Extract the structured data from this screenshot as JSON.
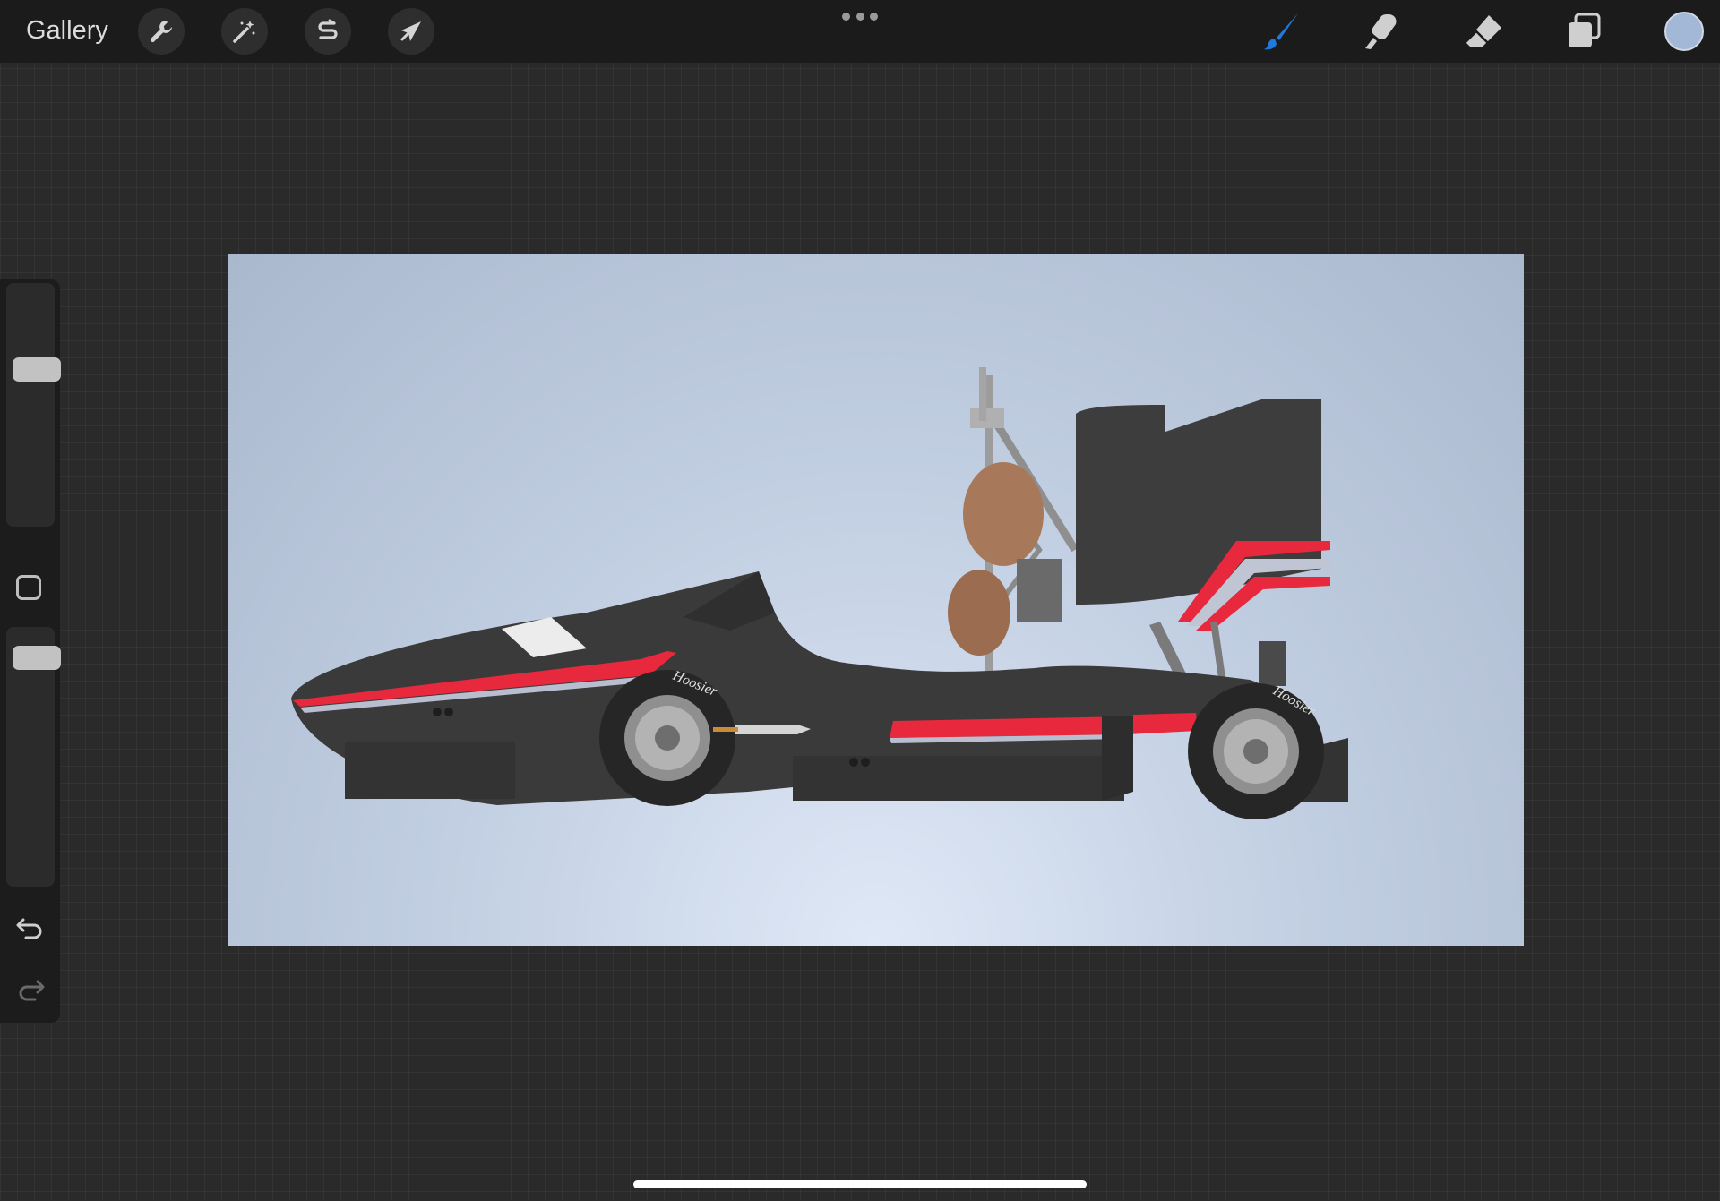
{
  "topbar": {
    "gallery_label": "Gallery",
    "left_tools": [
      {
        "name": "actions",
        "icon": "wrench-icon"
      },
      {
        "name": "adjustments",
        "icon": "magic-wand-icon"
      },
      {
        "name": "selection",
        "icon": "selection-s-icon"
      },
      {
        "name": "transform",
        "icon": "arrow-cursor-icon"
      }
    ],
    "more_icon": "ellipsis-icon",
    "right_tools": [
      {
        "name": "brush",
        "icon": "brush-icon",
        "active": true,
        "color": "#1f7ae0"
      },
      {
        "name": "smudge",
        "icon": "smudge-icon",
        "active": false
      },
      {
        "name": "eraser",
        "icon": "eraser-icon",
        "active": false
      },
      {
        "name": "layers",
        "icon": "layers-icon",
        "active": false
      }
    ],
    "current_color": "#a3b8d6"
  },
  "sidebar": {
    "brush_size": 0.66,
    "brush_opacity": 0.92,
    "modify_icon": "square-icon",
    "undo_icon": "undo-icon",
    "redo_icon": "redo-icon"
  },
  "canvas": {
    "artwork": "formula-student-race-car-side-view",
    "tire_brand_text": "Hoosier",
    "colors": {
      "body": "#3a3a3a",
      "stripe_red": "#e8283c",
      "background_light": "#dfe8f6",
      "background_dark": "#aab8ce"
    }
  }
}
